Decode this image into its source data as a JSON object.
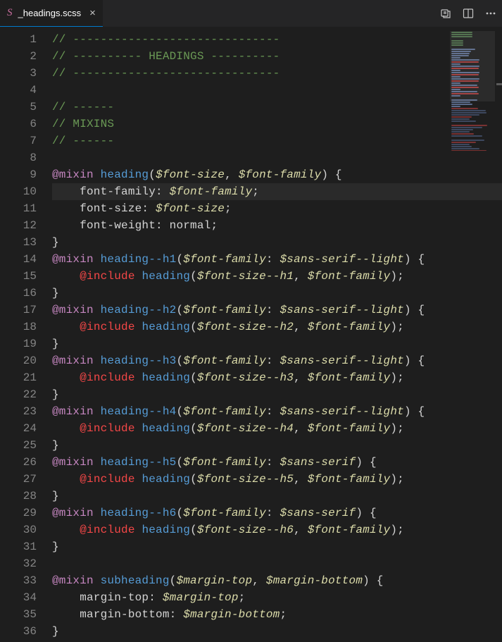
{
  "tab": {
    "filename": "_headings.scss"
  },
  "lines": [
    {
      "n": 1,
      "hl": false,
      "tokens": [
        {
          "t": "// ------------------------------",
          "c": "c-comment"
        }
      ]
    },
    {
      "n": 2,
      "hl": false,
      "tokens": [
        {
          "t": "// ---------- HEADINGS ----------",
          "c": "c-comment"
        }
      ]
    },
    {
      "n": 3,
      "hl": false,
      "tokens": [
        {
          "t": "// ------------------------------",
          "c": "c-comment"
        }
      ]
    },
    {
      "n": 4,
      "hl": false,
      "tokens": []
    },
    {
      "n": 5,
      "hl": false,
      "tokens": [
        {
          "t": "// ------",
          "c": "c-comment"
        }
      ]
    },
    {
      "n": 6,
      "hl": false,
      "tokens": [
        {
          "t": "// MIXINS",
          "c": "c-comment"
        }
      ]
    },
    {
      "n": 7,
      "hl": false,
      "tokens": [
        {
          "t": "// ------",
          "c": "c-comment"
        }
      ]
    },
    {
      "n": 8,
      "hl": false,
      "tokens": []
    },
    {
      "n": 9,
      "hl": false,
      "tokens": [
        {
          "t": "@mixin",
          "c": "c-keyword"
        },
        {
          "t": " ",
          "c": ""
        },
        {
          "t": "heading",
          "c": "c-func"
        },
        {
          "t": "(",
          "c": "c-punc"
        },
        {
          "t": "$font-size",
          "c": "c-var"
        },
        {
          "t": ", ",
          "c": "c-punc"
        },
        {
          "t": "$font-family",
          "c": "c-var"
        },
        {
          "t": ")",
          "c": "c-punc"
        },
        {
          "t": " {",
          "c": "c-punc"
        }
      ]
    },
    {
      "n": 10,
      "hl": true,
      "tokens": [
        {
          "t": "    font-family",
          "c": "c-prop"
        },
        {
          "t": ": ",
          "c": "c-punc"
        },
        {
          "t": "$font-family",
          "c": "c-var"
        },
        {
          "t": ";",
          "c": "c-punc"
        }
      ]
    },
    {
      "n": 11,
      "hl": false,
      "tokens": [
        {
          "t": "    font-size",
          "c": "c-prop"
        },
        {
          "t": ": ",
          "c": "c-punc"
        },
        {
          "t": "$font-size",
          "c": "c-var"
        },
        {
          "t": ";",
          "c": "c-punc"
        }
      ]
    },
    {
      "n": 12,
      "hl": false,
      "tokens": [
        {
          "t": "    font-weight",
          "c": "c-prop"
        },
        {
          "t": ": ",
          "c": "c-punc"
        },
        {
          "t": "normal",
          "c": "c-value"
        },
        {
          "t": ";",
          "c": "c-punc"
        }
      ]
    },
    {
      "n": 13,
      "hl": false,
      "tokens": [
        {
          "t": "}",
          "c": "c-punc"
        }
      ]
    },
    {
      "n": 14,
      "hl": false,
      "tokens": [
        {
          "t": "@mixin",
          "c": "c-keyword"
        },
        {
          "t": " ",
          "c": ""
        },
        {
          "t": "heading--h1",
          "c": "c-func"
        },
        {
          "t": "(",
          "c": "c-punc"
        },
        {
          "t": "$font-family",
          "c": "c-var"
        },
        {
          "t": ": ",
          "c": "c-punc"
        },
        {
          "t": "$sans-serif--light",
          "c": "c-var"
        },
        {
          "t": ")",
          "c": "c-punc"
        },
        {
          "t": " {",
          "c": "c-punc"
        }
      ]
    },
    {
      "n": 15,
      "hl": false,
      "tokens": [
        {
          "t": "    ",
          "c": ""
        },
        {
          "t": "@include",
          "c": "c-include"
        },
        {
          "t": " ",
          "c": ""
        },
        {
          "t": "heading",
          "c": "c-func"
        },
        {
          "t": "(",
          "c": "c-punc"
        },
        {
          "t": "$font-size--h1",
          "c": "c-var"
        },
        {
          "t": ", ",
          "c": "c-punc"
        },
        {
          "t": "$font-family",
          "c": "c-var"
        },
        {
          "t": ")",
          "c": "c-punc"
        },
        {
          "t": ";",
          "c": "c-punc"
        }
      ]
    },
    {
      "n": 16,
      "hl": false,
      "tokens": [
        {
          "t": "}",
          "c": "c-punc"
        }
      ]
    },
    {
      "n": 17,
      "hl": false,
      "tokens": [
        {
          "t": "@mixin",
          "c": "c-keyword"
        },
        {
          "t": " ",
          "c": ""
        },
        {
          "t": "heading--h2",
          "c": "c-func"
        },
        {
          "t": "(",
          "c": "c-punc"
        },
        {
          "t": "$font-family",
          "c": "c-var"
        },
        {
          "t": ": ",
          "c": "c-punc"
        },
        {
          "t": "$sans-serif--light",
          "c": "c-var"
        },
        {
          "t": ")",
          "c": "c-punc"
        },
        {
          "t": " {",
          "c": "c-punc"
        }
      ]
    },
    {
      "n": 18,
      "hl": false,
      "tokens": [
        {
          "t": "    ",
          "c": ""
        },
        {
          "t": "@include",
          "c": "c-include"
        },
        {
          "t": " ",
          "c": ""
        },
        {
          "t": "heading",
          "c": "c-func"
        },
        {
          "t": "(",
          "c": "c-punc"
        },
        {
          "t": "$font-size--h2",
          "c": "c-var"
        },
        {
          "t": ", ",
          "c": "c-punc"
        },
        {
          "t": "$font-family",
          "c": "c-var"
        },
        {
          "t": ")",
          "c": "c-punc"
        },
        {
          "t": ";",
          "c": "c-punc"
        }
      ]
    },
    {
      "n": 19,
      "hl": false,
      "tokens": [
        {
          "t": "}",
          "c": "c-punc"
        }
      ]
    },
    {
      "n": 20,
      "hl": false,
      "tokens": [
        {
          "t": "@mixin",
          "c": "c-keyword"
        },
        {
          "t": " ",
          "c": ""
        },
        {
          "t": "heading--h3",
          "c": "c-func"
        },
        {
          "t": "(",
          "c": "c-punc"
        },
        {
          "t": "$font-family",
          "c": "c-var"
        },
        {
          "t": ": ",
          "c": "c-punc"
        },
        {
          "t": "$sans-serif--light",
          "c": "c-var"
        },
        {
          "t": ")",
          "c": "c-punc"
        },
        {
          "t": " {",
          "c": "c-punc"
        }
      ]
    },
    {
      "n": 21,
      "hl": false,
      "tokens": [
        {
          "t": "    ",
          "c": ""
        },
        {
          "t": "@include",
          "c": "c-include"
        },
        {
          "t": " ",
          "c": ""
        },
        {
          "t": "heading",
          "c": "c-func"
        },
        {
          "t": "(",
          "c": "c-punc"
        },
        {
          "t": "$font-size--h3",
          "c": "c-var"
        },
        {
          "t": ", ",
          "c": "c-punc"
        },
        {
          "t": "$font-family",
          "c": "c-var"
        },
        {
          "t": ")",
          "c": "c-punc"
        },
        {
          "t": ";",
          "c": "c-punc"
        }
      ]
    },
    {
      "n": 22,
      "hl": false,
      "tokens": [
        {
          "t": "}",
          "c": "c-punc"
        }
      ]
    },
    {
      "n": 23,
      "hl": false,
      "tokens": [
        {
          "t": "@mixin",
          "c": "c-keyword"
        },
        {
          "t": " ",
          "c": ""
        },
        {
          "t": "heading--h4",
          "c": "c-func"
        },
        {
          "t": "(",
          "c": "c-punc"
        },
        {
          "t": "$font-family",
          "c": "c-var"
        },
        {
          "t": ": ",
          "c": "c-punc"
        },
        {
          "t": "$sans-serif--light",
          "c": "c-var"
        },
        {
          "t": ")",
          "c": "c-punc"
        },
        {
          "t": " {",
          "c": "c-punc"
        }
      ]
    },
    {
      "n": 24,
      "hl": false,
      "tokens": [
        {
          "t": "    ",
          "c": ""
        },
        {
          "t": "@include",
          "c": "c-include"
        },
        {
          "t": " ",
          "c": ""
        },
        {
          "t": "heading",
          "c": "c-func"
        },
        {
          "t": "(",
          "c": "c-punc"
        },
        {
          "t": "$font-size--h4",
          "c": "c-var"
        },
        {
          "t": ", ",
          "c": "c-punc"
        },
        {
          "t": "$font-family",
          "c": "c-var"
        },
        {
          "t": ")",
          "c": "c-punc"
        },
        {
          "t": ";",
          "c": "c-punc"
        }
      ]
    },
    {
      "n": 25,
      "hl": false,
      "tokens": [
        {
          "t": "}",
          "c": "c-punc"
        }
      ]
    },
    {
      "n": 26,
      "hl": false,
      "tokens": [
        {
          "t": "@mixin",
          "c": "c-keyword"
        },
        {
          "t": " ",
          "c": ""
        },
        {
          "t": "heading--h5",
          "c": "c-func"
        },
        {
          "t": "(",
          "c": "c-punc"
        },
        {
          "t": "$font-family",
          "c": "c-var"
        },
        {
          "t": ": ",
          "c": "c-punc"
        },
        {
          "t": "$sans-serif",
          "c": "c-var"
        },
        {
          "t": ")",
          "c": "c-punc"
        },
        {
          "t": " {",
          "c": "c-punc"
        }
      ]
    },
    {
      "n": 27,
      "hl": false,
      "tokens": [
        {
          "t": "    ",
          "c": ""
        },
        {
          "t": "@include",
          "c": "c-include"
        },
        {
          "t": " ",
          "c": ""
        },
        {
          "t": "heading",
          "c": "c-func"
        },
        {
          "t": "(",
          "c": "c-punc"
        },
        {
          "t": "$font-size--h5",
          "c": "c-var"
        },
        {
          "t": ", ",
          "c": "c-punc"
        },
        {
          "t": "$font-family",
          "c": "c-var"
        },
        {
          "t": ")",
          "c": "c-punc"
        },
        {
          "t": ";",
          "c": "c-punc"
        }
      ]
    },
    {
      "n": 28,
      "hl": false,
      "tokens": [
        {
          "t": "}",
          "c": "c-punc"
        }
      ]
    },
    {
      "n": 29,
      "hl": false,
      "tokens": [
        {
          "t": "@mixin",
          "c": "c-keyword"
        },
        {
          "t": " ",
          "c": ""
        },
        {
          "t": "heading--h6",
          "c": "c-func"
        },
        {
          "t": "(",
          "c": "c-punc"
        },
        {
          "t": "$font-family",
          "c": "c-var"
        },
        {
          "t": ": ",
          "c": "c-punc"
        },
        {
          "t": "$sans-serif",
          "c": "c-var"
        },
        {
          "t": ")",
          "c": "c-punc"
        },
        {
          "t": " {",
          "c": "c-punc"
        }
      ]
    },
    {
      "n": 30,
      "hl": false,
      "tokens": [
        {
          "t": "    ",
          "c": ""
        },
        {
          "t": "@include",
          "c": "c-include"
        },
        {
          "t": " ",
          "c": ""
        },
        {
          "t": "heading",
          "c": "c-func"
        },
        {
          "t": "(",
          "c": "c-punc"
        },
        {
          "t": "$font-size--h6",
          "c": "c-var"
        },
        {
          "t": ", ",
          "c": "c-punc"
        },
        {
          "t": "$font-family",
          "c": "c-var"
        },
        {
          "t": ")",
          "c": "c-punc"
        },
        {
          "t": ";",
          "c": "c-punc"
        }
      ]
    },
    {
      "n": 31,
      "hl": false,
      "tokens": [
        {
          "t": "}",
          "c": "c-punc"
        }
      ]
    },
    {
      "n": 32,
      "hl": false,
      "tokens": []
    },
    {
      "n": 33,
      "hl": false,
      "tokens": [
        {
          "t": "@mixin",
          "c": "c-keyword"
        },
        {
          "t": " ",
          "c": ""
        },
        {
          "t": "subheading",
          "c": "c-func"
        },
        {
          "t": "(",
          "c": "c-punc"
        },
        {
          "t": "$margin-top",
          "c": "c-var"
        },
        {
          "t": ", ",
          "c": "c-punc"
        },
        {
          "t": "$margin-bottom",
          "c": "c-var"
        },
        {
          "t": ")",
          "c": "c-punc"
        },
        {
          "t": " {",
          "c": "c-punc"
        }
      ]
    },
    {
      "n": 34,
      "hl": false,
      "tokens": [
        {
          "t": "    margin-top",
          "c": "c-prop"
        },
        {
          "t": ": ",
          "c": "c-punc"
        },
        {
          "t": "$margin-top",
          "c": "c-var"
        },
        {
          "t": ";",
          "c": "c-punc"
        }
      ]
    },
    {
      "n": 35,
      "hl": false,
      "tokens": [
        {
          "t": "    margin-bottom",
          "c": "c-prop"
        },
        {
          "t": ": ",
          "c": "c-punc"
        },
        {
          "t": "$margin-bottom",
          "c": "c-var"
        },
        {
          "t": ";",
          "c": "c-punc"
        }
      ]
    },
    {
      "n": 36,
      "hl": false,
      "tokens": [
        {
          "t": "}",
          "c": "c-punc"
        }
      ]
    }
  ]
}
